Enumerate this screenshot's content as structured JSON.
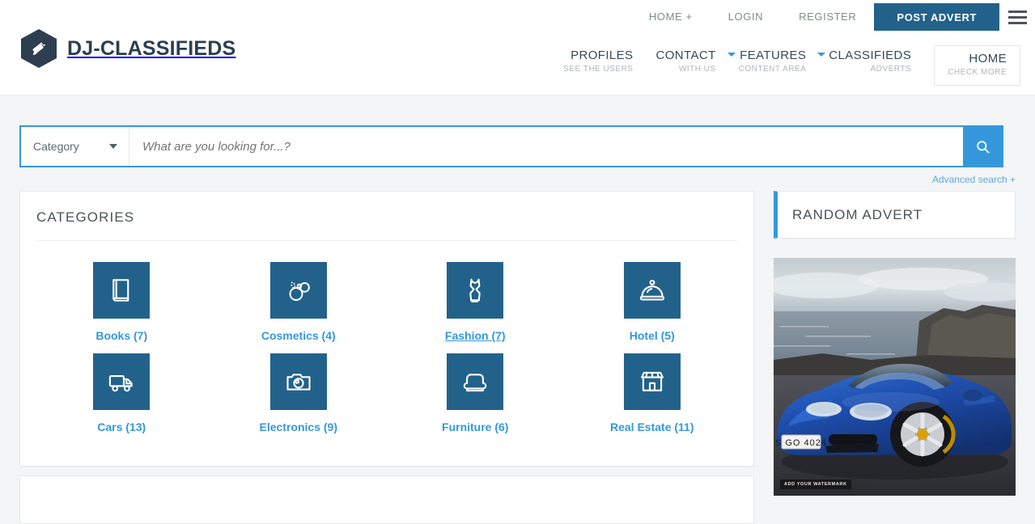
{
  "site": {
    "logo_text": "DJ-CLASSIFIEDS",
    "logo_icon": "megaphone-icon"
  },
  "topbar": {
    "links": [
      {
        "label": "HOME +",
        "name": "home"
      },
      {
        "label": "LOGIN",
        "name": "login"
      },
      {
        "label": "REGISTER",
        "name": "register"
      }
    ],
    "post_advert": "POST ADVERT",
    "menu_icon": "hamburger-icon"
  },
  "mainnav": {
    "items": [
      {
        "title": "PROFILES",
        "sub": "SEE THE USERS",
        "caret": false,
        "active": false
      },
      {
        "title": "CONTACT",
        "sub": "WITH US",
        "caret": false,
        "active": false
      },
      {
        "title": "FEATURES",
        "sub": "CONTENT AREA",
        "caret": true,
        "active": false
      },
      {
        "title": "CLASSIFIEDS",
        "sub": "ADVERTS",
        "caret": true,
        "active": false
      },
      {
        "title": "HOME",
        "sub": "CHECK MORE",
        "caret": false,
        "active": true
      }
    ]
  },
  "search": {
    "category_label": "Category",
    "placeholder": "What are you looking for...?",
    "value": "",
    "button_icon": "search-icon",
    "advanced_label": "Advanced search +"
  },
  "categories_panel": {
    "title": "CATEGORIES",
    "items": [
      {
        "label": "Books (7)",
        "icon": "book-icon",
        "hovered": false
      },
      {
        "label": "Cosmetics (4)",
        "icon": "perfume-icon",
        "hovered": false
      },
      {
        "label": "Fashion (7)",
        "icon": "dress-icon",
        "hovered": true
      },
      {
        "label": "Hotel (5)",
        "icon": "cloche-icon",
        "hovered": false
      },
      {
        "label": "Cars (13)",
        "icon": "truck-icon",
        "hovered": false
      },
      {
        "label": "Electronics (9)",
        "icon": "camera-icon",
        "hovered": false
      },
      {
        "label": "Furniture (6)",
        "icon": "armchair-icon",
        "hovered": false
      },
      {
        "label": "Real Estate (11)",
        "icon": "shop-icon",
        "hovered": false
      }
    ]
  },
  "random_advert": {
    "title": "RANDOM ADVERT",
    "image_alt": "blue-sports-car-by-the-ocean",
    "license_plate": "S  GO 4024",
    "watermark": "ADD YOUR WATERMARK"
  },
  "colors": {
    "brand_dark": "#2c3e50",
    "accent_blue": "#3498db",
    "icon_tile": "#22628a",
    "page_bg": "#f3f5f6"
  }
}
